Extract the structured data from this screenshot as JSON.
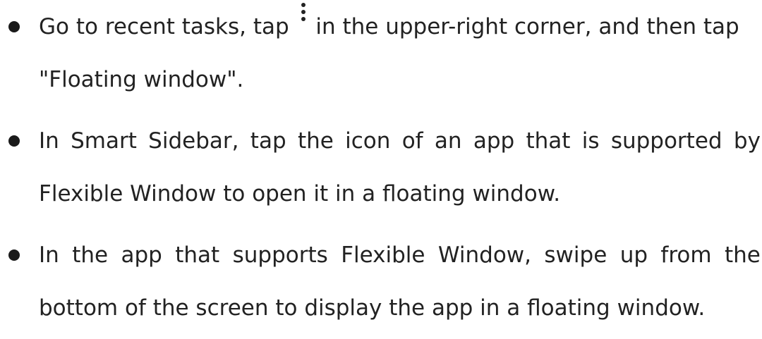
{
  "bullets": [
    {
      "before_icon": "Go to recent tasks, tap",
      "icon": "more-options-vertical-dots-icon",
      "after_icon": "in the upper-right corner, and then tap",
      "line2": "\"Floating window\"."
    },
    {
      "line1_words": [
        "In",
        "Smart",
        "Sidebar,",
        "tap",
        "the",
        "icon",
        "of",
        "an",
        "app",
        "that",
        "is",
        "supported",
        "by"
      ],
      "line2": "Flexible Window to open it in a floating window."
    },
    {
      "line1_words": [
        "In",
        "the",
        "app",
        "that",
        "supports",
        "Flexible",
        "Window,",
        "swipe",
        "up",
        "from",
        "the"
      ],
      "line2": "bottom of the screen to display the app in a floating window."
    }
  ]
}
